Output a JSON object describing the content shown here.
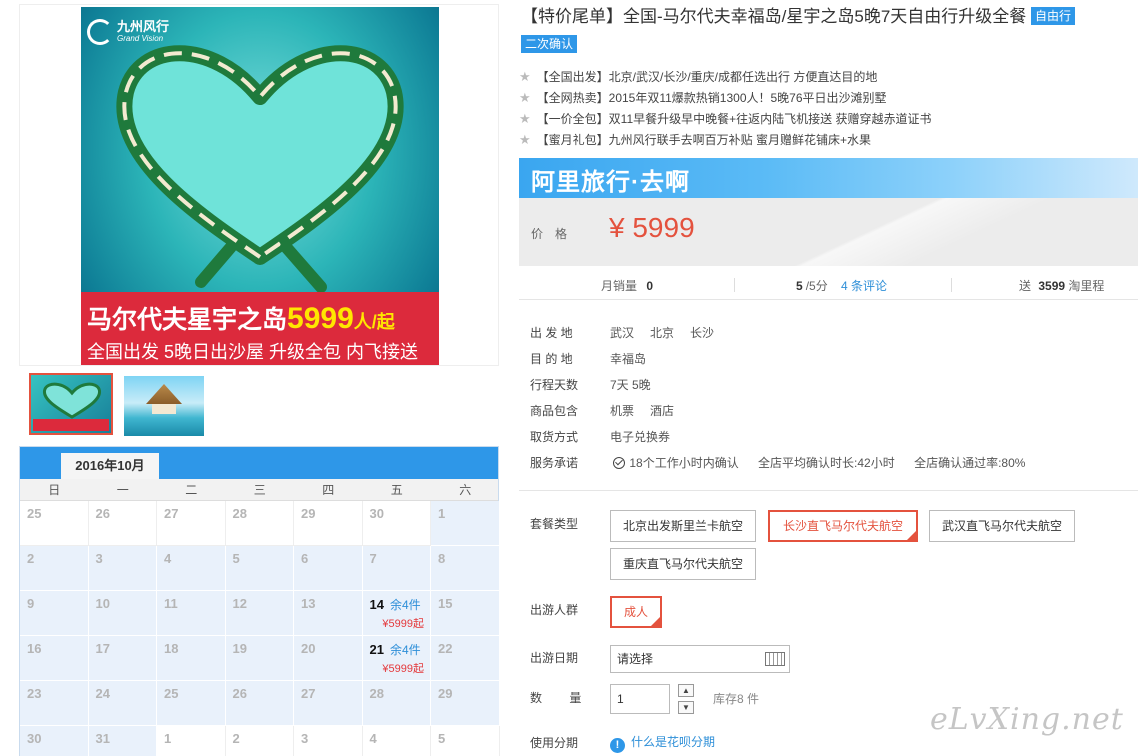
{
  "product_image": {
    "brand_cn": "九州风行",
    "brand_en": "Grand Vision",
    "banner_main": "马尔代夫星宇之岛",
    "banner_price": "5999",
    "banner_unit": "人/起",
    "banner_sub": "全国出发 5晚日出沙屋 升级全包 内飞接送"
  },
  "calendar": {
    "month": "2016年10月",
    "weekdays": [
      "日",
      "一",
      "二",
      "三",
      "四",
      "五",
      "六"
    ],
    "cells": [
      {
        "day": "25",
        "other": true
      },
      {
        "day": "26",
        "other": true
      },
      {
        "day": "27",
        "other": true
      },
      {
        "day": "28",
        "other": true
      },
      {
        "day": "29",
        "other": true
      },
      {
        "day": "30",
        "other": true
      },
      {
        "day": "1"
      },
      {
        "day": "2"
      },
      {
        "day": "3"
      },
      {
        "day": "4"
      },
      {
        "day": "5"
      },
      {
        "day": "6"
      },
      {
        "day": "7"
      },
      {
        "day": "8"
      },
      {
        "day": "9"
      },
      {
        "day": "10"
      },
      {
        "day": "11"
      },
      {
        "day": "12"
      },
      {
        "day": "13"
      },
      {
        "day": "14",
        "stock": "余4件",
        "price": "¥5999起"
      },
      {
        "day": "15"
      },
      {
        "day": "16"
      },
      {
        "day": "17"
      },
      {
        "day": "18"
      },
      {
        "day": "19"
      },
      {
        "day": "20"
      },
      {
        "day": "21",
        "stock": "余4件",
        "price": "¥5999起"
      },
      {
        "day": "22"
      },
      {
        "day": "23"
      },
      {
        "day": "24"
      },
      {
        "day": "25"
      },
      {
        "day": "26"
      },
      {
        "day": "27"
      },
      {
        "day": "28"
      },
      {
        "day": "29"
      },
      {
        "day": "30"
      },
      {
        "day": "31"
      },
      {
        "day": "1",
        "other": true
      },
      {
        "day": "2",
        "other": true
      },
      {
        "day": "3",
        "other": true
      },
      {
        "day": "4",
        "other": true
      },
      {
        "day": "5",
        "other": true
      }
    ]
  },
  "title": {
    "text": "【特价尾单】全国-马尔代夫幸福岛/星宇之岛5晚7天自由行升级全餐",
    "tag": "自由行",
    "tag2": "二次确认"
  },
  "features": [
    "【全国出发】北京/武汉/长沙/重庆/成都任选出行 方便直达目的地",
    "【全网热卖】2015年双11爆款热销1300人！5晚76平日出沙滩别墅",
    "【一价全包】双11早餐升级早中晚餐+往返内陆飞机接送 获赠穿越赤道证书",
    "【蜜月礼包】九州风行联手去啊百万补贴 蜜月赠鲜花铺床+水果"
  ],
  "ali_bar": "阿里旅行·去啊",
  "price": {
    "label": "价格",
    "value": "¥ 5999"
  },
  "stats": {
    "sales_label": "月销量",
    "sales_value": "0",
    "rating_value": "5",
    "rating_suffix": "/5分",
    "reviews": "4 条评论",
    "points_label": "送",
    "points_value": "3599",
    "points_suffix": "淘里程"
  },
  "info": [
    {
      "label": "出 发 地",
      "values": [
        "武汉",
        "北京",
        "长沙"
      ]
    },
    {
      "label": "目 的 地",
      "values": [
        "幸福岛"
      ]
    },
    {
      "label": "行程天数",
      "values": [
        "7天 5晚"
      ]
    },
    {
      "label": "商品包含",
      "values": [
        "机票",
        "酒店"
      ]
    },
    {
      "label": "取货方式",
      "values": [
        "电子兑换券"
      ]
    }
  ],
  "service": {
    "label": "服务承诺",
    "items": [
      "18个工作小时内确认",
      "全店平均确认时长:42小时",
      "全店确认通过率:80%"
    ]
  },
  "options": {
    "package_label": "套餐类型",
    "packages": [
      "北京出发斯里兰卡航空",
      "长沙直飞马尔代夫航空",
      "武汉直飞马尔代夫航空",
      "重庆直飞马尔代夫航空"
    ],
    "crowd_label": "出游人群",
    "crowd": "成人",
    "date_label": "出游日期",
    "date_placeholder": "请选择",
    "qty_label": "数 量",
    "qty_value": "1",
    "stock": "库存8 件",
    "installment_label": "使用分期",
    "installment_link": "什么是花呗分期"
  },
  "watermark": "eLvXing.net",
  "colors": {
    "accent": "#2e97e8",
    "price": "#e4523e",
    "banner": "#dc2a3c"
  }
}
